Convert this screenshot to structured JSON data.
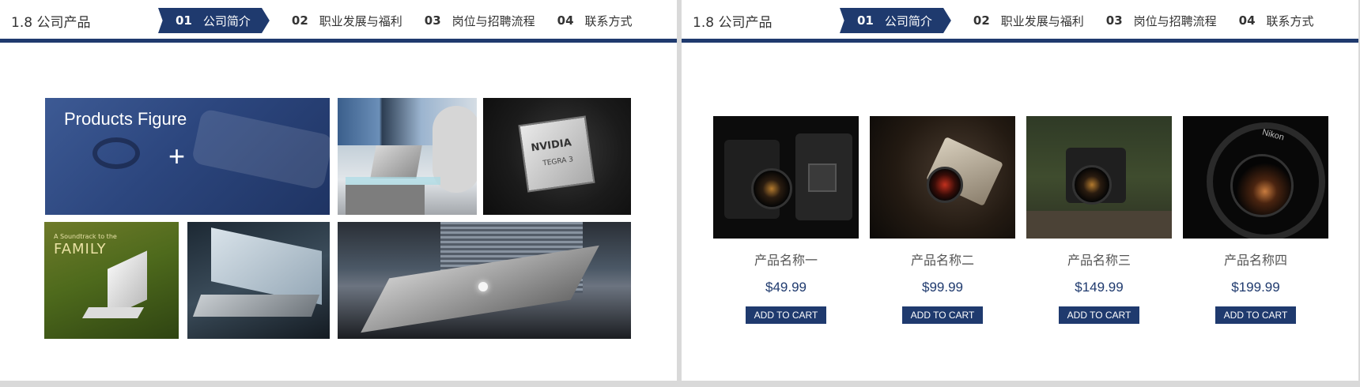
{
  "header": {
    "title": "1.8 公司产品",
    "nav": [
      {
        "num": "01",
        "label": "公司简介",
        "active": true
      },
      {
        "num": "02",
        "label": "职业发展与福利",
        "active": false
      },
      {
        "num": "03",
        "label": "岗位与招聘流程",
        "active": false
      },
      {
        "num": "04",
        "label": "联系方式",
        "active": false
      }
    ]
  },
  "left_slide": {
    "featured_caption": "Products Figure",
    "featured_plus": "+",
    "chip_brand": "NVIDIA",
    "chip_model": "TEGRA 3",
    "grass_small": "A Soundtrack to the",
    "grass_big": "FAMILY"
  },
  "right_slide": {
    "products": [
      {
        "name": "产品名称一",
        "price": "$49.99",
        "button": "ADD TO CART"
      },
      {
        "name": "产品名称二",
        "price": "$99.99",
        "button": "ADD TO CART"
      },
      {
        "name": "产品名称三",
        "price": "$149.99",
        "button": "ADD TO CART"
      },
      {
        "name": "产品名称四",
        "price": "$199.99",
        "button": "ADD TO CART"
      }
    ],
    "lens_brand": "Nikon"
  },
  "colors": {
    "accent": "#1f3a6e",
    "background": "#ffffff",
    "divider": "#d9d9d9"
  }
}
